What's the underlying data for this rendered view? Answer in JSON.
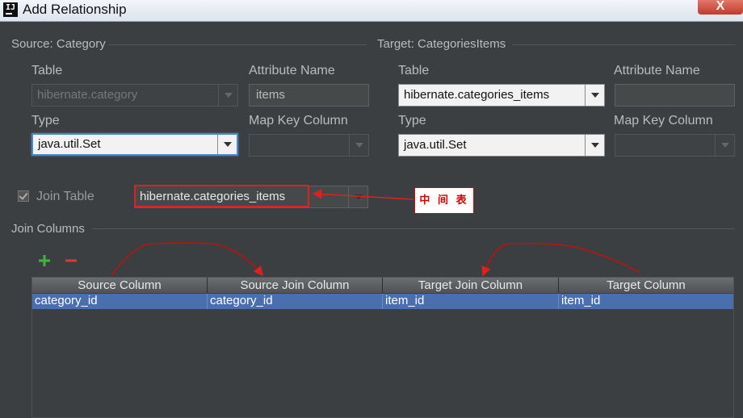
{
  "window": {
    "title": "Add Relationship",
    "app_icon": "intellij-icon",
    "close": "X"
  },
  "source": {
    "header": "Source: Category",
    "table_label": "Table",
    "table_value": "hibernate.category",
    "attr_label": "Attribute Name",
    "attr_value": "items",
    "type_label": "Type",
    "type_value": "java.util.Set",
    "mapkey_label": "Map Key Column",
    "mapkey_value": ""
  },
  "target": {
    "header": "Target: CategoriesItems",
    "table_label": "Table",
    "table_value": "hibernate.categories_items",
    "attr_label": "Attribute Name",
    "attr_value": "",
    "type_label": "Type",
    "type_value": "java.util.Set",
    "mapkey_label": "Map Key Column",
    "mapkey_value": ""
  },
  "join_table": {
    "label": "Join Table",
    "checked": true,
    "value": "hibernate.categories_items"
  },
  "annotation": {
    "label": "中 间 表",
    "color": "#e02020"
  },
  "join_columns": {
    "header": "Join Columns",
    "add_icon": "plus-icon",
    "remove_icon": "minus-icon",
    "columns": [
      "Source Column",
      "Source Join Column",
      "Target Join Column",
      "Target Column"
    ],
    "rows": [
      [
        "category_id",
        "category_id",
        "item_id",
        "item_id"
      ]
    ]
  },
  "colors": {
    "background": "#3c3f41",
    "selection": "#4b6eaf",
    "focus": "#4a88c7"
  }
}
